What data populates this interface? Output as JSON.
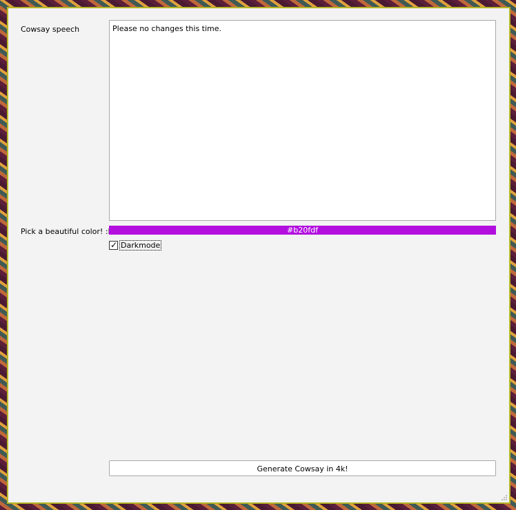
{
  "form": {
    "speech_label": "Cowsay speech",
    "speech_text": "Please no changes this time.",
    "color_label": "Pick a beautiful color! :D",
    "color_value": "#b20fdf",
    "darkmode_label": "Darkmode",
    "darkmode_checked": true,
    "generate_label": "Generate Cowsay in 4k!"
  },
  "colors": {
    "window_border": "#b5b827",
    "window_bg": "#f3f3f3",
    "swatch": "#b20fdf"
  }
}
